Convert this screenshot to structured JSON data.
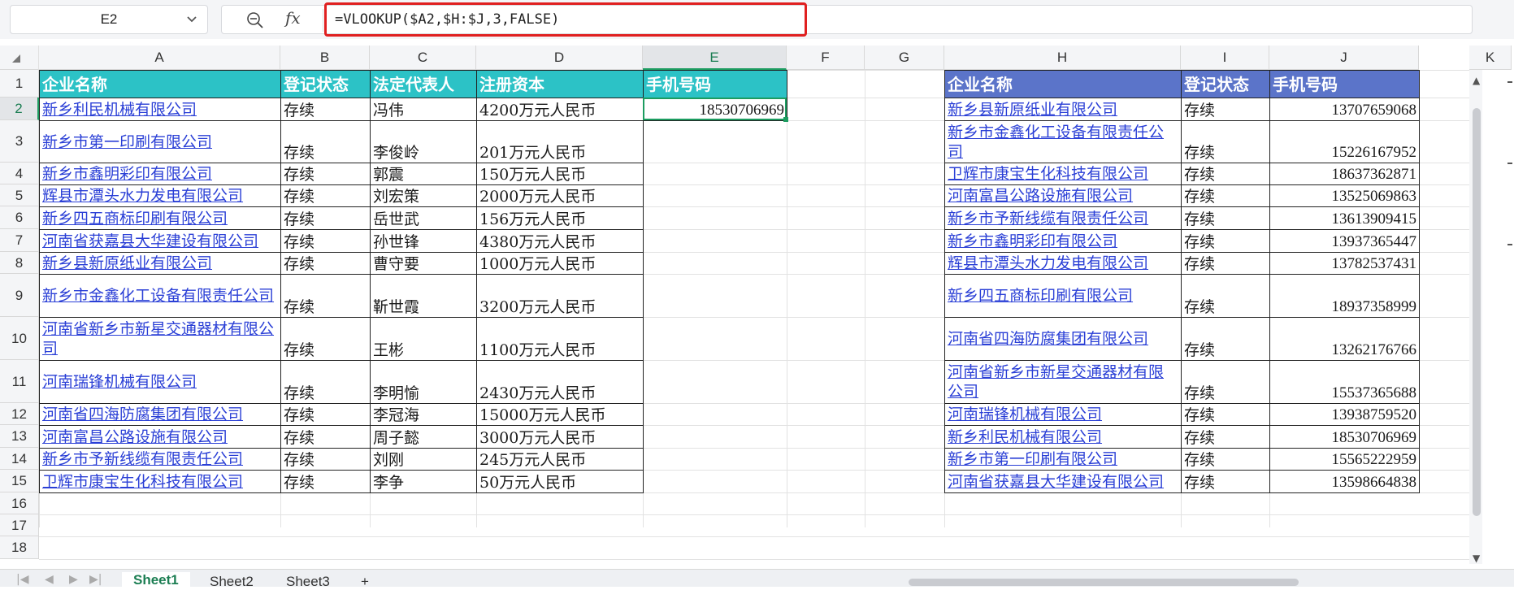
{
  "toolbar": {
    "name_box": "E2",
    "formula": "=VLOOKUP($A2,$H:$J,3,FALSE)"
  },
  "columns": [
    "A",
    "B",
    "C",
    "D",
    "E",
    "F",
    "G",
    "H",
    "I",
    "J",
    "K"
  ],
  "rows": [
    "1",
    "2",
    "3",
    "4",
    "5",
    "6",
    "7",
    "8",
    "9",
    "10",
    "11",
    "12",
    "13",
    "14",
    "15",
    "16",
    "17",
    "18"
  ],
  "table1": {
    "headers": [
      "企业名称",
      "登记状态",
      "法定代表人",
      "注册资本",
      "手机号码"
    ],
    "rows": [
      [
        "新乡利民机械有限公司",
        "存续",
        "冯伟",
        "4200万元人民币",
        "18530706969"
      ],
      [
        "新乡市第一印刷有限公司",
        "存续",
        "李俊岭",
        "201万元人民币",
        ""
      ],
      [
        "新乡市鑫明彩印有限公司",
        "存续",
        "郭震",
        "150万元人民币",
        ""
      ],
      [
        "辉县市潭头水力发电有限公司",
        "存续",
        "刘宏策",
        "2000万元人民币",
        ""
      ],
      [
        "新乡四五商标印刷有限公司",
        "存续",
        "岳世武",
        "156万元人民币",
        ""
      ],
      [
        "河南省获嘉县大华建设有限公司",
        "存续",
        "孙世锋",
        "4380万元人民币",
        ""
      ],
      [
        "新乡县新原纸业有限公司",
        "存续",
        "曹守要",
        "1000万元人民币",
        ""
      ],
      [
        "新乡市金鑫化工设备有限责任公司",
        "存续",
        "靳世霞",
        "3200万元人民币",
        ""
      ],
      [
        "河南省新乡市新星交通器材有限公司",
        "存续",
        "王彬",
        "1100万元人民币",
        ""
      ],
      [
        "河南瑞锋机械有限公司",
        "存续",
        "李明愉",
        "2430万元人民币",
        ""
      ],
      [
        "河南省四海防腐集团有限公司",
        "存续",
        "李冠海",
        "15000万元人民币",
        ""
      ],
      [
        "河南富昌公路设施有限公司",
        "存续",
        "周子懿",
        "3000万元人民币",
        ""
      ],
      [
        "新乡市予新线缆有限责任公司",
        "存续",
        "刘刚",
        "245万元人民币",
        ""
      ],
      [
        "卫辉市康宝生化科技有限公司",
        "存续",
        "李争",
        "50万元人民币",
        ""
      ]
    ]
  },
  "table2": {
    "headers": [
      "企业名称",
      "登记状态",
      "手机号码"
    ],
    "rows": [
      [
        "新乡县新原纸业有限公司",
        "存续",
        "13707659068"
      ],
      [
        "新乡市金鑫化工设备有限责任公司",
        "存续",
        "15226167952"
      ],
      [
        "卫辉市康宝生化科技有限公司",
        "存续",
        "18637362871"
      ],
      [
        "河南富昌公路设施有限公司",
        "存续",
        "13525069863"
      ],
      [
        "新乡市予新线缆有限责任公司",
        "存续",
        "13613909415"
      ],
      [
        "新乡市鑫明彩印有限公司",
        "存续",
        "13937365447"
      ],
      [
        "辉县市潭头水力发电有限公司",
        "存续",
        "13782537431"
      ],
      [
        "新乡四五商标印刷有限公司",
        "存续",
        "18937358999"
      ],
      [
        "河南省四海防腐集团有限公司",
        "存续",
        "13262176766"
      ],
      [
        "河南省新乡市新星交通器材有限公司",
        "存续",
        "15537365688"
      ],
      [
        "河南瑞锋机械有限公司",
        "存续",
        "13938759520"
      ],
      [
        "新乡利民机械有限公司",
        "存续",
        "18530706969"
      ],
      [
        "新乡市第一印刷有限公司",
        "存续",
        "15565222959"
      ],
      [
        "河南省获嘉县大华建设有限公司",
        "存续",
        "13598664838"
      ]
    ]
  },
  "sheets": [
    "Sheet1",
    "Sheet2",
    "Sheet3"
  ]
}
